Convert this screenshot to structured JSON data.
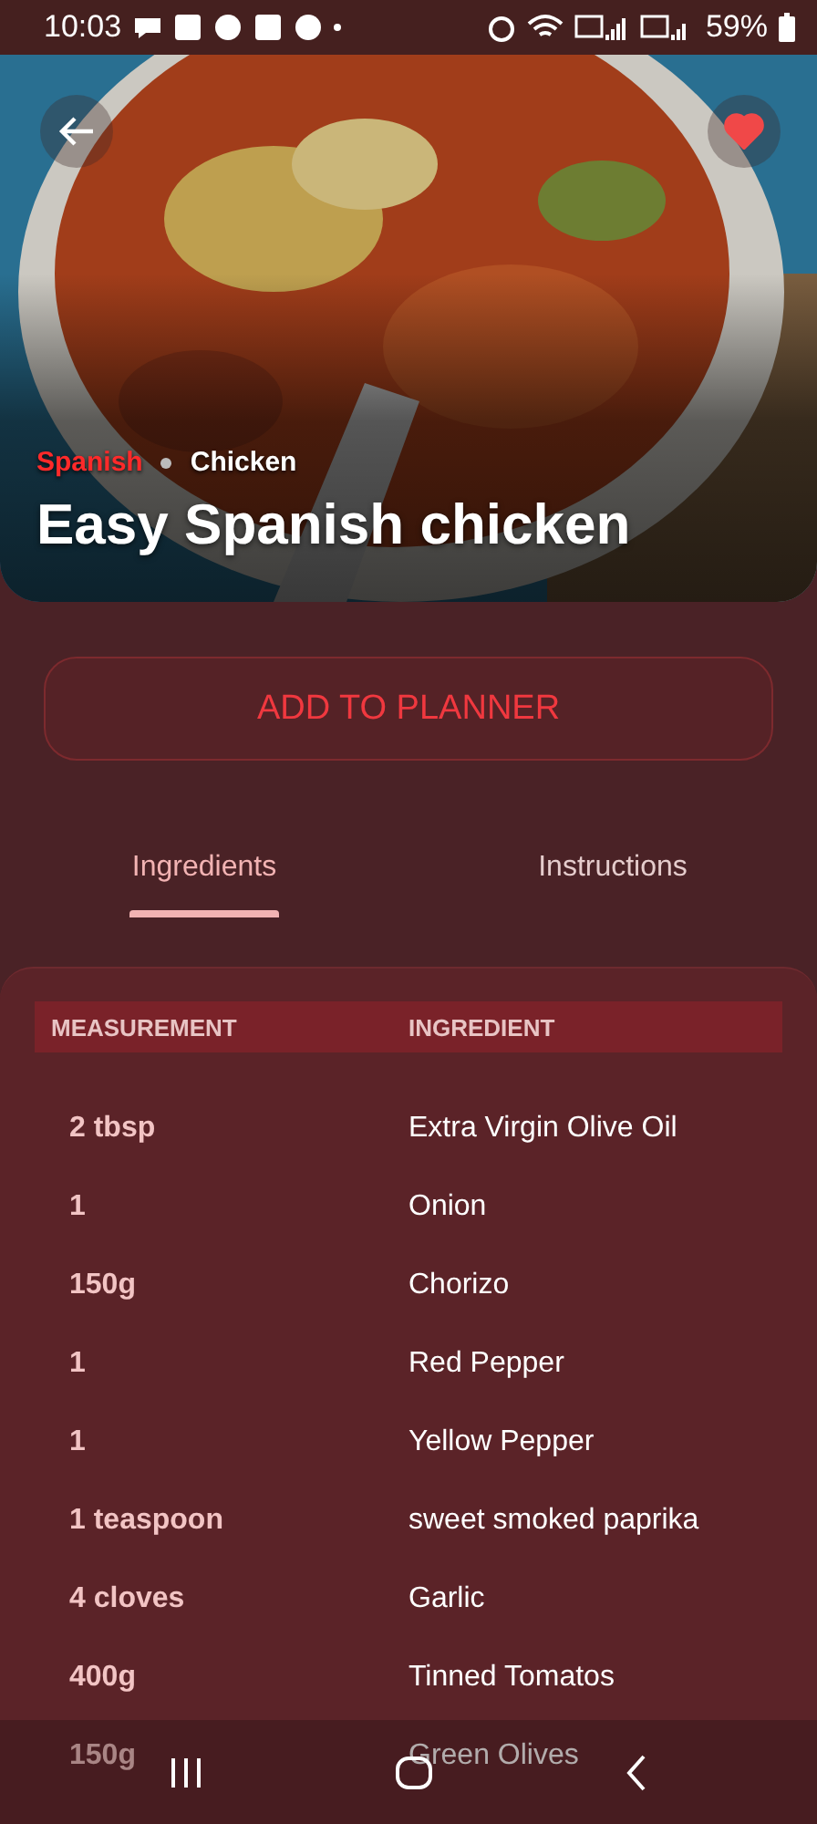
{
  "status_bar": {
    "time": "10:03",
    "battery": "59%"
  },
  "recipe": {
    "tags": [
      {
        "label": "Spanish",
        "kind": "area"
      },
      {
        "label": "Chicken",
        "kind": "category"
      }
    ],
    "title": "Easy Spanish chicken",
    "favorite": true
  },
  "planner_button": "ADD TO PLANNER",
  "tabs": [
    {
      "label": "Ingredients",
      "selected": true
    },
    {
      "label": "Instructions",
      "selected": false
    }
  ],
  "table": {
    "columns": [
      "MEASUREMENT",
      "INGREDIENT"
    ],
    "rows": [
      [
        "2 tbsp",
        "Extra Virgin Olive Oil"
      ],
      [
        "1",
        "Onion"
      ],
      [
        "150g",
        "Chorizo"
      ],
      [
        "1",
        "Red Pepper"
      ],
      [
        "1",
        "Yellow Pepper"
      ],
      [
        "1 teaspoon",
        "sweet smoked paprika"
      ],
      [
        "4 cloves",
        "Garlic"
      ],
      [
        "400g",
        "Tinned Tomatos"
      ],
      [
        "150g",
        "Green Olives"
      ]
    ]
  }
}
